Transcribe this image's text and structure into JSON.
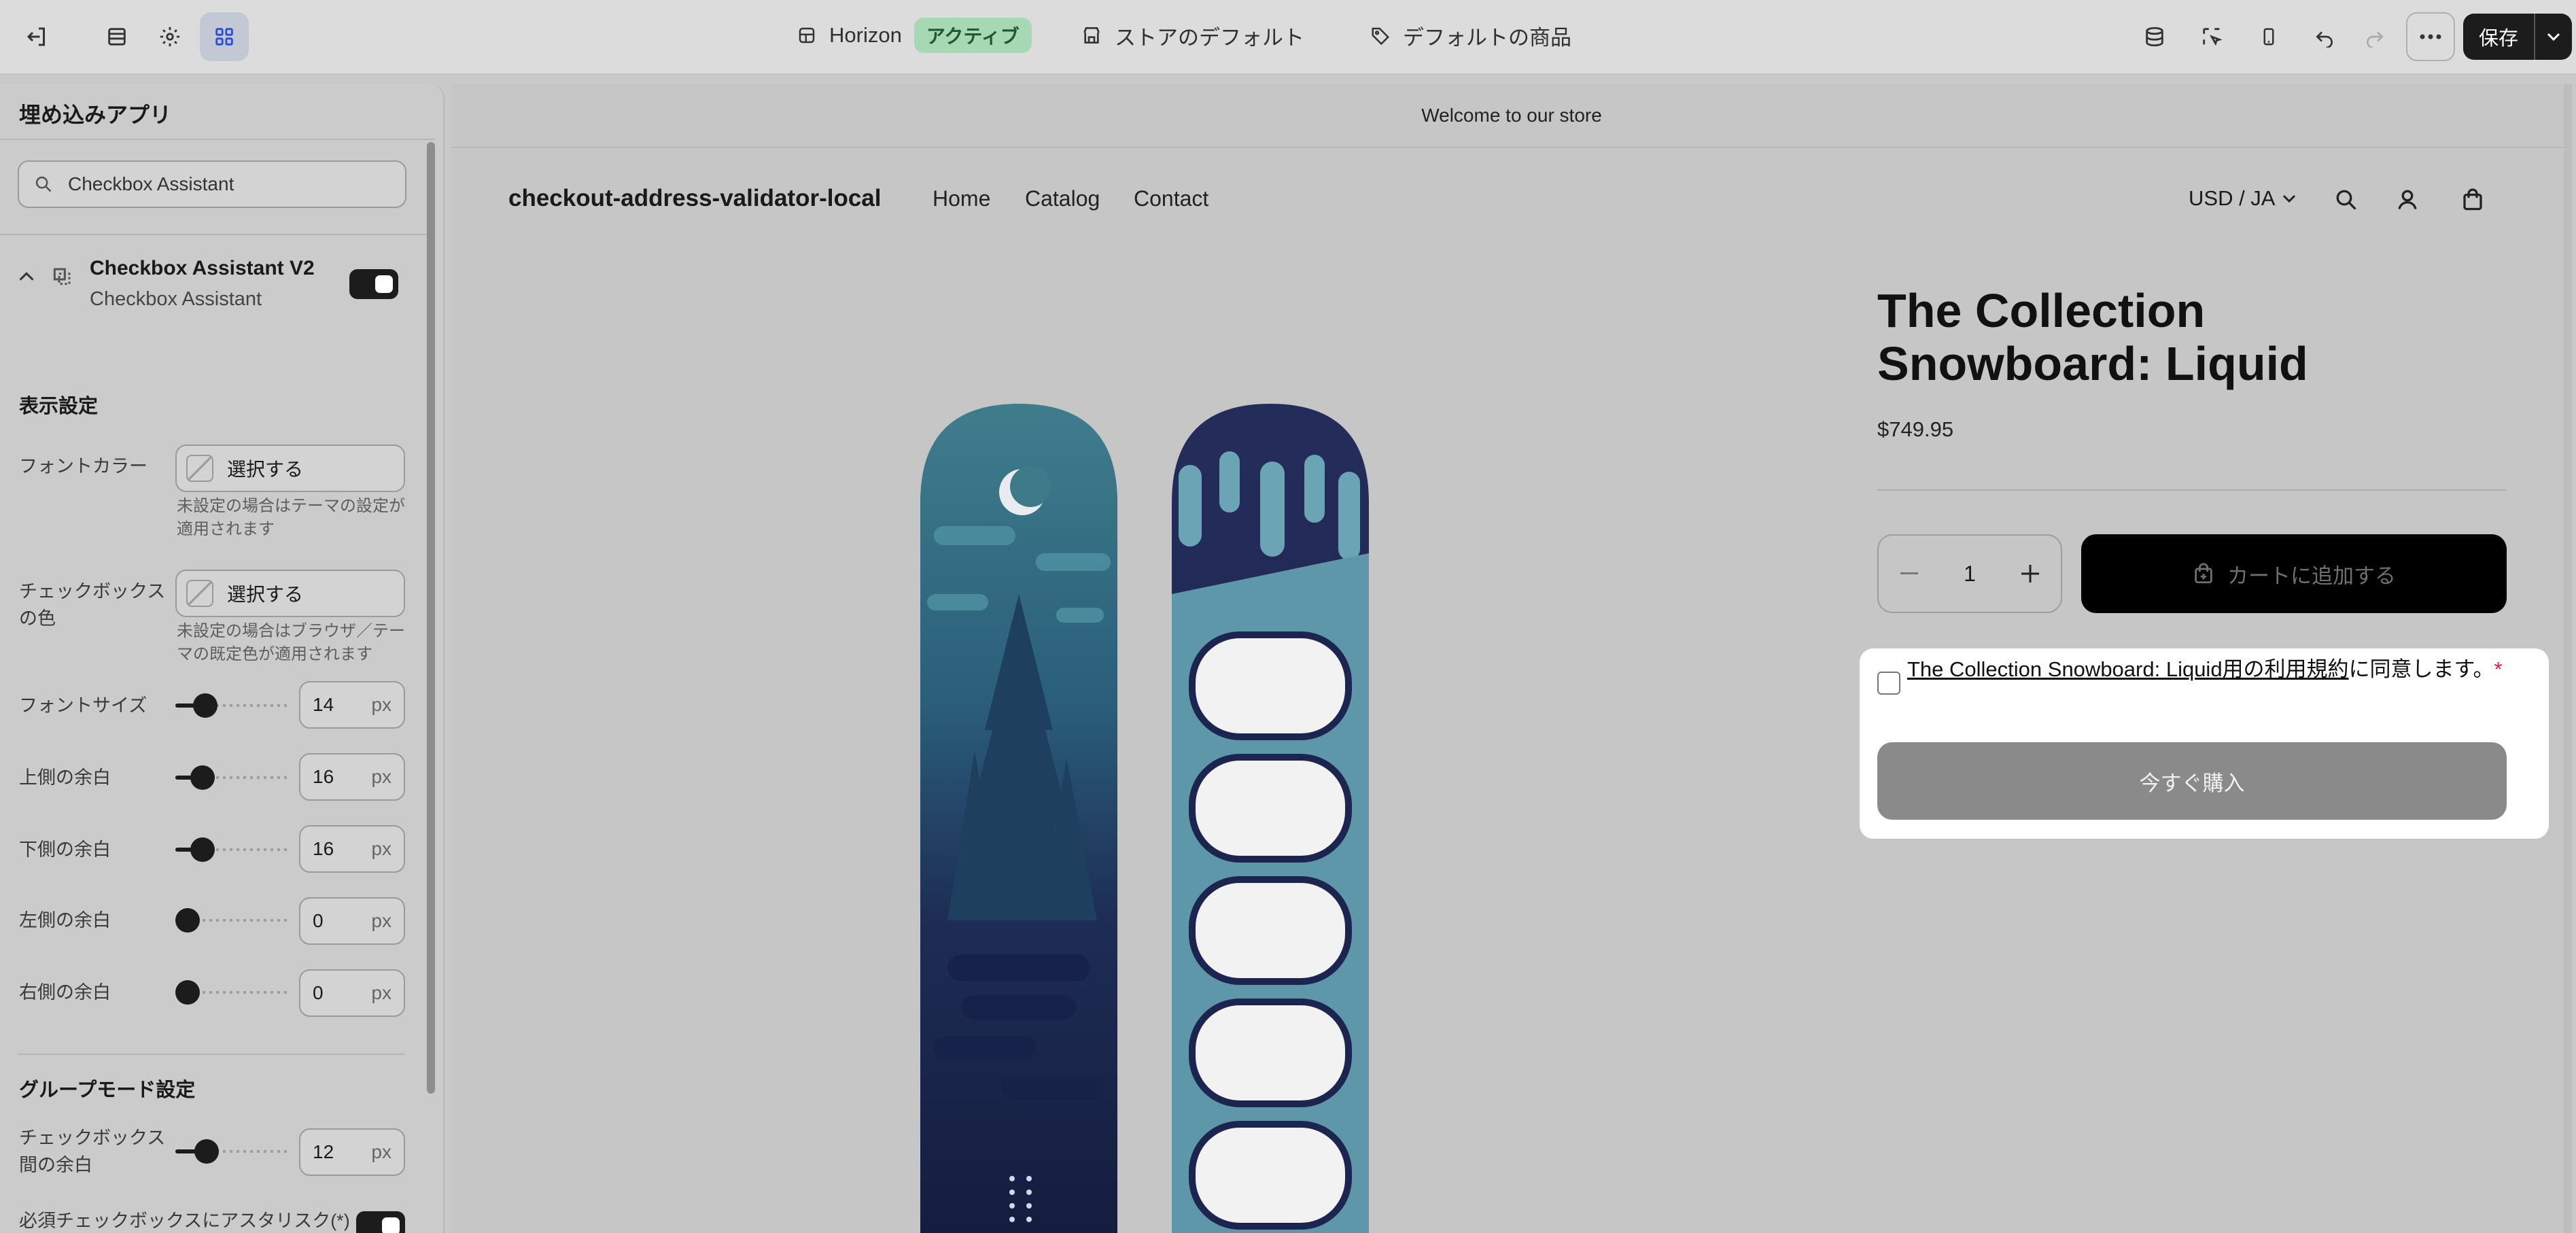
{
  "topbar": {
    "theme_name": "Horizon",
    "theme_status": "アクティブ",
    "store_default": "ストアのデフォルト",
    "product_default": "デフォルトの商品",
    "save_label": "保存"
  },
  "panel": {
    "title": "埋め込みアプリ",
    "search_value": "Checkbox Assistant",
    "app": {
      "name": "Checkbox Assistant V2",
      "subtitle": "Checkbox Assistant",
      "enabled": true
    },
    "display_settings": {
      "title": "表示設定",
      "font_color": {
        "label": "フォントカラー",
        "button": "選択する",
        "help": "未設定の場合はテーマの設定が適用されます"
      },
      "checkbox_color": {
        "label": "チェックボックスの色",
        "button": "選択する",
        "help": "未設定の場合はブラウザ／テーマの既定色が適用されます"
      },
      "unit": "px",
      "sliders": [
        {
          "label": "フォントサイズ",
          "value": "14"
        },
        {
          "label": "上側の余白",
          "value": "16"
        },
        {
          "label": "下側の余白",
          "value": "16"
        },
        {
          "label": "左側の余白",
          "value": "0"
        },
        {
          "label": "右側の余白",
          "value": "0"
        }
      ]
    },
    "group_mode": {
      "title": "グループモード設定",
      "spacing": {
        "label": "チェックボックス間の余白",
        "value": "12"
      },
      "asterisk_label": "必須チェックボックスにアスタリスク(*)"
    }
  },
  "store": {
    "announcement": "Welcome to our store",
    "name": "checkout-address-validator-local",
    "nav": [
      "Home",
      "Catalog",
      "Contact"
    ],
    "currency": "USD / JA",
    "product": {
      "title": "The Collection Snowboard: Liquid",
      "price": "$749.95",
      "quantity": "1",
      "add_to_cart": "カートに追加する",
      "checkbox_link": "The Collection Snowboard: Liquid用の利用規約",
      "checkbox_rest": "に同意します。",
      "required_mark": "*",
      "buy_now": "今すぐ購入"
    }
  },
  "colors": {
    "accent_badge": "#a6d9b3",
    "required": "#e0203f",
    "active_tool": "#c2c9d4"
  }
}
